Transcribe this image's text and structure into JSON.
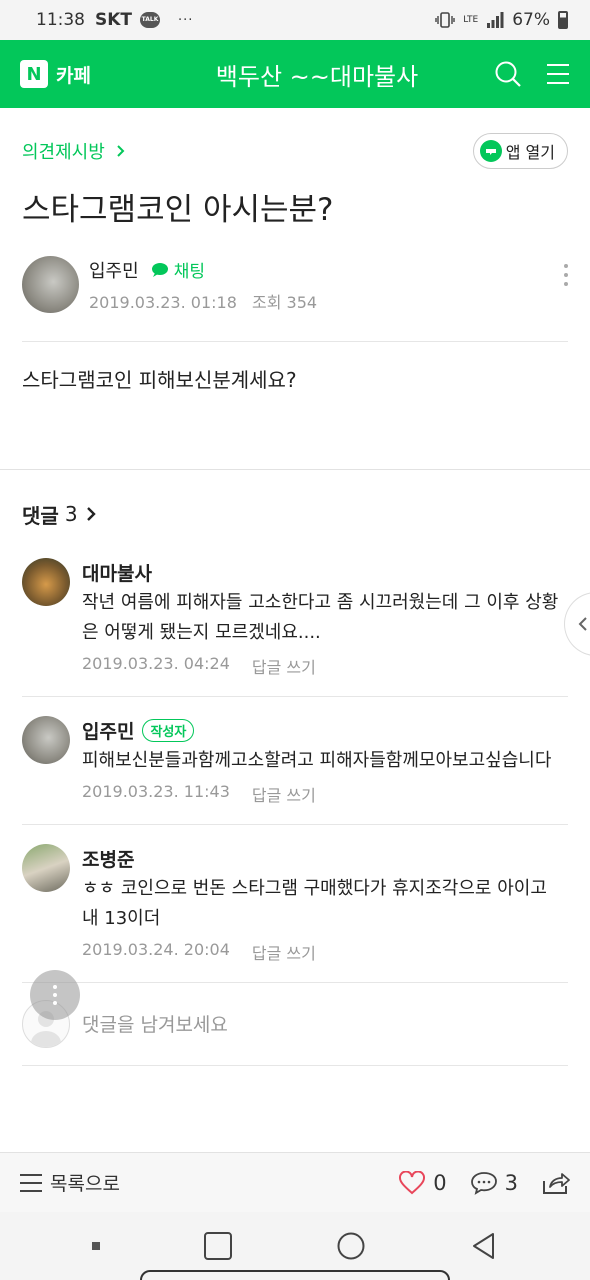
{
  "status_bar": {
    "time": "11:38",
    "carrier": "SKT",
    "talk_label": "TALK",
    "notif_dots": "···",
    "network": "LTE",
    "battery": "67%"
  },
  "header": {
    "logo_letter": "N",
    "logo_text": "카페",
    "cafe_name": "백두산 ~~대마불사"
  },
  "post": {
    "board": "의견제시방",
    "app_open_label": "앱 열기",
    "title": "스타그램코인 아시는분?",
    "author": "입주민",
    "chat_label": "채팅",
    "date": "2019.03.23. 01:18",
    "views": "조회 354",
    "body": "스타그램코인 피해보신분계세요?"
  },
  "comments": {
    "label": "댓글",
    "count": "3",
    "items": [
      {
        "name": "대마불사",
        "text": "작년 여름에 피해자들 고소한다고 좀 시끄러웠는데 그 이후 상황은 어떻게 됐는지 모르겠네요....",
        "date": "2019.03.23. 04:24",
        "reply": "답글 쓰기"
      },
      {
        "name": "입주민",
        "badge": "작성자",
        "text": "피해보신분들과함께고소할려고 피해자들함께모아보고싶습니다",
        "date": "2019.03.23. 11:43",
        "reply": "답글 쓰기"
      },
      {
        "name": "조병준",
        "text": "ㅎㅎ 코인으로 번돈 스타그램 구매했다가 휴지조각으로 아이고 내 13이더",
        "date": "2019.03.24. 20:04",
        "reply": "답글 쓰기"
      }
    ],
    "write_placeholder": "댓글을 남겨보세요"
  },
  "action_bar": {
    "list_label": "목록으로",
    "likes": "0",
    "comment_count": "3"
  },
  "colors": {
    "brand": "#03c75a",
    "heart": "#e8465a"
  }
}
